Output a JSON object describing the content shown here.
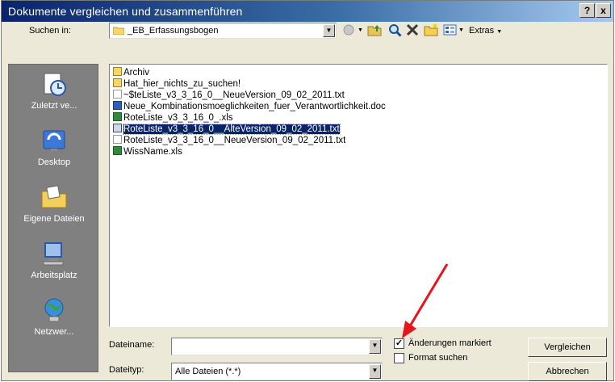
{
  "window": {
    "title": "Dokumente vergleichen und zusammenführen",
    "help_button": "?",
    "close_button": "x"
  },
  "lookin": {
    "label": "Suchen in:",
    "value": "_EB_Erfassungsbogen"
  },
  "toolbar": {
    "extras_label": "Extras"
  },
  "places": [
    {
      "label": "Zuletzt ve...",
      "icon": "recent-documents-icon"
    },
    {
      "label": "Desktop",
      "icon": "desktop-icon"
    },
    {
      "label": "Eigene Dateien",
      "icon": "my-documents-icon"
    },
    {
      "label": "Arbeitsplatz",
      "icon": "my-computer-icon"
    },
    {
      "label": "Netzwer...",
      "icon": "network-places-icon"
    }
  ],
  "files": [
    {
      "name": "Archiv",
      "type": "folder"
    },
    {
      "name": "Hat_hier_nichts_zu_suchen!",
      "type": "folder"
    },
    {
      "name": "~$teListe_v3_3_16_0__NeueVersion_09_02_2011.txt",
      "type": "txt"
    },
    {
      "name": "Neue_Kombinationsmoeglichkeiten_fuer_Verantwortlichkeit.doc",
      "type": "doc"
    },
    {
      "name": "RoteListe_v3_3_16_0_.xls",
      "type": "xls"
    },
    {
      "name": "RoteListe_v3_3_16_0__AlteVersion_09_02_2011.txt",
      "type": "txt",
      "selected": true
    },
    {
      "name": "RoteListe_v3_3_16_0__NeueVersion_09_02_2011.txt",
      "type": "txt"
    },
    {
      "name": "WissName.xls",
      "type": "xls"
    }
  ],
  "filename": {
    "label": "Dateiname:",
    "value": ""
  },
  "filetype": {
    "label": "Dateityp:",
    "value": "Alle Dateien (*.*)"
  },
  "options": {
    "track_changes_label": "Änderungen markiert",
    "track_changes_checked": true,
    "find_format_label": "Format suchen",
    "find_format_checked": false
  },
  "buttons": {
    "compare": "Vergleichen",
    "cancel": "Abbrechen"
  },
  "colors": {
    "titlebar": "#0a246a",
    "selection": "#0a246a",
    "annotation_arrow": "#e8141c"
  }
}
